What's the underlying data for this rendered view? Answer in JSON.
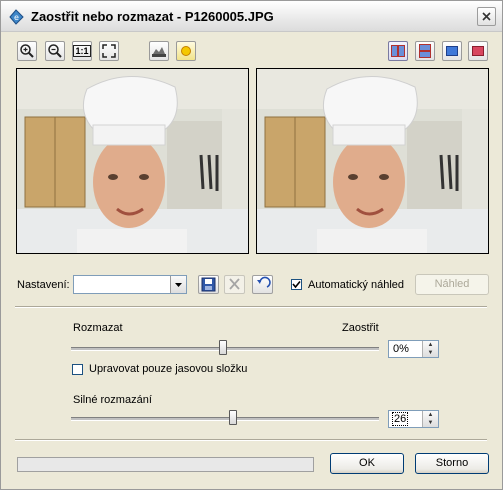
{
  "window": {
    "title": "Zaostřit nebo rozmazat - P1260005.JPG"
  },
  "toolbar": {
    "zoom_reset_label": "1:1"
  },
  "settings": {
    "label": "Nastavení:",
    "value": "",
    "auto_preview_label": "Automatický náhled",
    "auto_preview_checked": true,
    "preview_button": "Náhled"
  },
  "sharpen": {
    "left_label": "Rozmazat",
    "right_label": "Zaostřit",
    "value": "0%",
    "level": 0,
    "luminance_only_label": "Upravovat pouze jasovou složku",
    "luminance_only_checked": false
  },
  "blur": {
    "label": "Silné rozmazání",
    "value": "26"
  },
  "buttons": {
    "ok": "OK",
    "cancel": "Storno"
  },
  "colors": {
    "accent": "#003c74",
    "photo_cabinet": "#c9a56a",
    "photo_wall": "#dcdcd5"
  }
}
